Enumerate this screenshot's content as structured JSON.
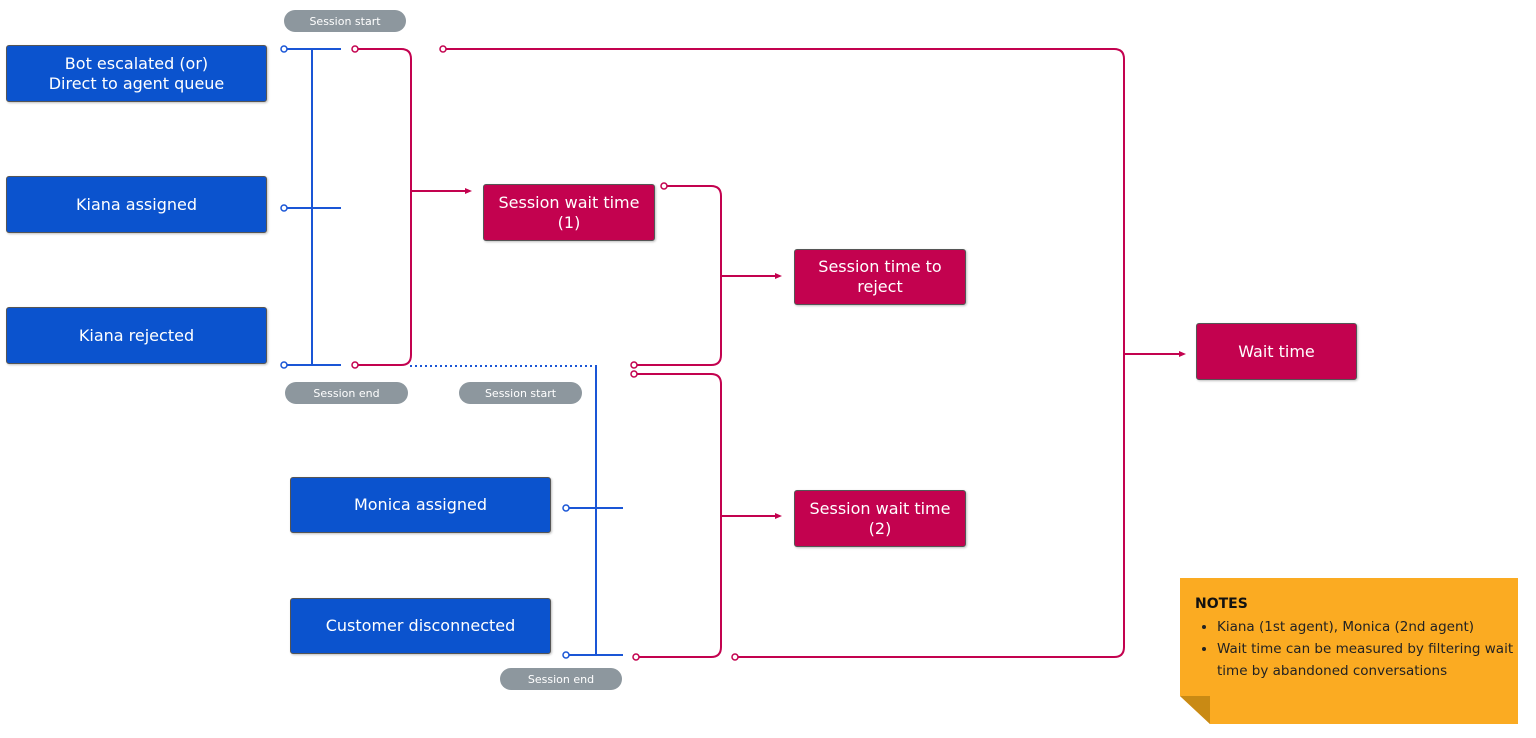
{
  "colors": {
    "event_box": "#0b53ce",
    "metric_box": "#c3024f",
    "session_pill": "#8d979e",
    "notes": "#fbab22"
  },
  "events": [
    {
      "label": "Bot escalated (or)\nDirect to agent queue"
    },
    {
      "label": "Kiana assigned"
    },
    {
      "label": "Kiana rejected"
    },
    {
      "label": "Monica assigned"
    },
    {
      "label": "Customer disconnected"
    }
  ],
  "metrics": [
    {
      "label": "Session wait time\n(1)"
    },
    {
      "label": "Session time to\nreject"
    },
    {
      "label": "Session wait time\n(2)"
    },
    {
      "label": "Wait time"
    }
  ],
  "pills": [
    "Session start",
    "Session end",
    "Session start",
    "Session end"
  ],
  "notes": {
    "title": "NOTES",
    "items": [
      "Kiana (1st agent), Monica (2nd agent)",
      "Wait time can be measured by filtering wait time by abandoned conversations"
    ]
  }
}
